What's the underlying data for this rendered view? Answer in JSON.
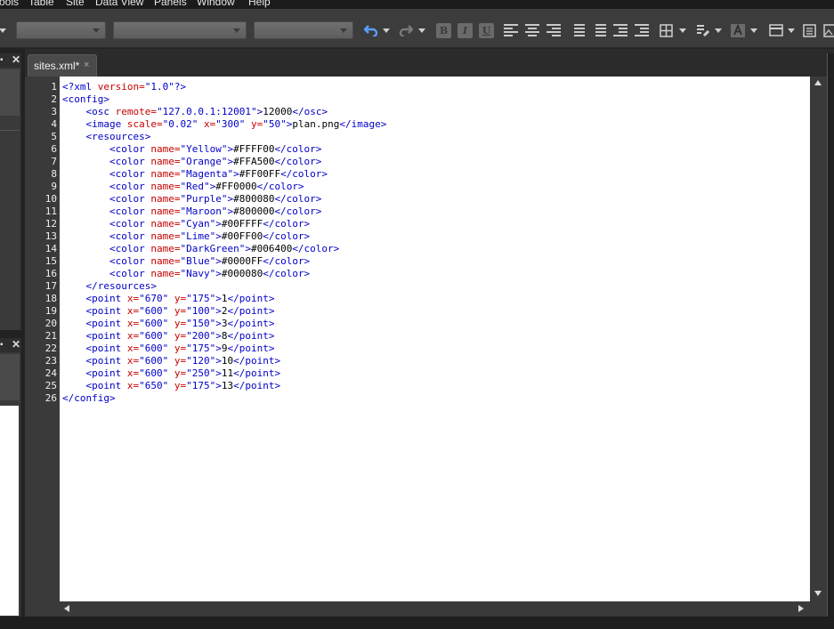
{
  "menu": {
    "items": [
      "ools",
      "Table",
      "Site",
      "Data View",
      "Panels",
      "Window",
      "Help"
    ]
  },
  "toolbar": {
    "bold_label": "B",
    "italic_label": "I",
    "underline_label": "U"
  },
  "tabs": [
    {
      "label": "sites.xml*",
      "close": "×"
    }
  ],
  "left_panel": {
    "pin": "▪",
    "close": "✕"
  },
  "colors": {
    "tag": "#0000c8",
    "attribute": "#c80000",
    "value": "#0000c8",
    "text": "#000000"
  },
  "editor": {
    "line_numbers": [
      "1",
      "2",
      "3",
      "4",
      "5",
      "6",
      "7",
      "8",
      "9",
      "10",
      "11",
      "12",
      "13",
      "14",
      "15",
      "16",
      "17",
      "18",
      "19",
      "20",
      "21",
      "22",
      "23",
      "24",
      "25",
      "26"
    ],
    "lines": [
      [
        {
          "c": "t",
          "s": "<?xml "
        },
        {
          "c": "a",
          "s": "version="
        },
        {
          "c": "v",
          "s": "\"1.0\""
        },
        {
          "c": "t",
          "s": "?>"
        }
      ],
      [
        {
          "c": "t",
          "s": "<config>"
        }
      ],
      [
        {
          "c": "x",
          "s": "    "
        },
        {
          "c": "t",
          "s": "<osc "
        },
        {
          "c": "a",
          "s": "remote="
        },
        {
          "c": "v",
          "s": "\"127.0.0.1:12001\""
        },
        {
          "c": "t",
          "s": ">"
        },
        {
          "c": "x",
          "s": "12000"
        },
        {
          "c": "t",
          "s": "</osc>"
        }
      ],
      [
        {
          "c": "x",
          "s": "    "
        },
        {
          "c": "t",
          "s": "<image "
        },
        {
          "c": "a",
          "s": "scale="
        },
        {
          "c": "v",
          "s": "\"0.02\""
        },
        {
          "c": "x",
          "s": " "
        },
        {
          "c": "a",
          "s": "x="
        },
        {
          "c": "v",
          "s": "\"300\""
        },
        {
          "c": "x",
          "s": " "
        },
        {
          "c": "a",
          "s": "y="
        },
        {
          "c": "v",
          "s": "\"50\""
        },
        {
          "c": "t",
          "s": ">"
        },
        {
          "c": "x",
          "s": "plan.png"
        },
        {
          "c": "t",
          "s": "</image>"
        }
      ],
      [
        {
          "c": "x",
          "s": "    "
        },
        {
          "c": "t",
          "s": "<resources>"
        }
      ],
      [
        {
          "c": "x",
          "s": "        "
        },
        {
          "c": "t",
          "s": "<color "
        },
        {
          "c": "a",
          "s": "name="
        },
        {
          "c": "v",
          "s": "\"Yellow\""
        },
        {
          "c": "t",
          "s": ">"
        },
        {
          "c": "x",
          "s": "#FFFF00"
        },
        {
          "c": "t",
          "s": "</color>"
        }
      ],
      [
        {
          "c": "x",
          "s": "        "
        },
        {
          "c": "t",
          "s": "<color "
        },
        {
          "c": "a",
          "s": "name="
        },
        {
          "c": "v",
          "s": "\"Orange\""
        },
        {
          "c": "t",
          "s": ">"
        },
        {
          "c": "x",
          "s": "#FFA500"
        },
        {
          "c": "t",
          "s": "</color>"
        }
      ],
      [
        {
          "c": "x",
          "s": "        "
        },
        {
          "c": "t",
          "s": "<color "
        },
        {
          "c": "a",
          "s": "name="
        },
        {
          "c": "v",
          "s": "\"Magenta\""
        },
        {
          "c": "t",
          "s": ">"
        },
        {
          "c": "x",
          "s": "#FF00FF"
        },
        {
          "c": "t",
          "s": "</color>"
        }
      ],
      [
        {
          "c": "x",
          "s": "        "
        },
        {
          "c": "t",
          "s": "<color "
        },
        {
          "c": "a",
          "s": "name="
        },
        {
          "c": "v",
          "s": "\"Red\""
        },
        {
          "c": "t",
          "s": ">"
        },
        {
          "c": "x",
          "s": "#FF0000"
        },
        {
          "c": "t",
          "s": "</color>"
        }
      ],
      [
        {
          "c": "x",
          "s": "        "
        },
        {
          "c": "t",
          "s": "<color "
        },
        {
          "c": "a",
          "s": "name="
        },
        {
          "c": "v",
          "s": "\"Purple\""
        },
        {
          "c": "t",
          "s": ">"
        },
        {
          "c": "x",
          "s": "#800080"
        },
        {
          "c": "t",
          "s": "</color>"
        }
      ],
      [
        {
          "c": "x",
          "s": "        "
        },
        {
          "c": "t",
          "s": "<color "
        },
        {
          "c": "a",
          "s": "name="
        },
        {
          "c": "v",
          "s": "\"Maroon\""
        },
        {
          "c": "t",
          "s": ">"
        },
        {
          "c": "x",
          "s": "#800000"
        },
        {
          "c": "t",
          "s": "</color>"
        }
      ],
      [
        {
          "c": "x",
          "s": "        "
        },
        {
          "c": "t",
          "s": "<color "
        },
        {
          "c": "a",
          "s": "name="
        },
        {
          "c": "v",
          "s": "\"Cyan\""
        },
        {
          "c": "t",
          "s": ">"
        },
        {
          "c": "x",
          "s": "#00FFFF"
        },
        {
          "c": "t",
          "s": "</color>"
        }
      ],
      [
        {
          "c": "x",
          "s": "        "
        },
        {
          "c": "t",
          "s": "<color "
        },
        {
          "c": "a",
          "s": "name="
        },
        {
          "c": "v",
          "s": "\"Lime\""
        },
        {
          "c": "t",
          "s": ">"
        },
        {
          "c": "x",
          "s": "#00FF00"
        },
        {
          "c": "t",
          "s": "</color>"
        }
      ],
      [
        {
          "c": "x",
          "s": "        "
        },
        {
          "c": "t",
          "s": "<color "
        },
        {
          "c": "a",
          "s": "name="
        },
        {
          "c": "v",
          "s": "\"DarkGreen\""
        },
        {
          "c": "t",
          "s": ">"
        },
        {
          "c": "x",
          "s": "#006400"
        },
        {
          "c": "t",
          "s": "</color>"
        }
      ],
      [
        {
          "c": "x",
          "s": "        "
        },
        {
          "c": "t",
          "s": "<color "
        },
        {
          "c": "a",
          "s": "name="
        },
        {
          "c": "v",
          "s": "\"Blue\""
        },
        {
          "c": "t",
          "s": ">"
        },
        {
          "c": "x",
          "s": "#0000FF"
        },
        {
          "c": "t",
          "s": "</color>"
        }
      ],
      [
        {
          "c": "x",
          "s": "        "
        },
        {
          "c": "t",
          "s": "<color "
        },
        {
          "c": "a",
          "s": "name="
        },
        {
          "c": "v",
          "s": "\"Navy\""
        },
        {
          "c": "t",
          "s": ">"
        },
        {
          "c": "x",
          "s": "#000080"
        },
        {
          "c": "t",
          "s": "</color>"
        }
      ],
      [
        {
          "c": "x",
          "s": "    "
        },
        {
          "c": "t",
          "s": "</resources>"
        }
      ],
      [
        {
          "c": "x",
          "s": "    "
        },
        {
          "c": "t",
          "s": "<point "
        },
        {
          "c": "a",
          "s": "x="
        },
        {
          "c": "v",
          "s": "\"670\""
        },
        {
          "c": "x",
          "s": " "
        },
        {
          "c": "a",
          "s": "y="
        },
        {
          "c": "v",
          "s": "\"175\""
        },
        {
          "c": "t",
          "s": ">"
        },
        {
          "c": "x",
          "s": "1"
        },
        {
          "c": "t",
          "s": "</point>"
        }
      ],
      [
        {
          "c": "x",
          "s": "    "
        },
        {
          "c": "t",
          "s": "<point "
        },
        {
          "c": "a",
          "s": "x="
        },
        {
          "c": "v",
          "s": "\"600\""
        },
        {
          "c": "x",
          "s": " "
        },
        {
          "c": "a",
          "s": "y="
        },
        {
          "c": "v",
          "s": "\"100\""
        },
        {
          "c": "t",
          "s": ">"
        },
        {
          "c": "x",
          "s": "2"
        },
        {
          "c": "t",
          "s": "</point>"
        }
      ],
      [
        {
          "c": "x",
          "s": "    "
        },
        {
          "c": "t",
          "s": "<point "
        },
        {
          "c": "a",
          "s": "x="
        },
        {
          "c": "v",
          "s": "\"600\""
        },
        {
          "c": "x",
          "s": " "
        },
        {
          "c": "a",
          "s": "y="
        },
        {
          "c": "v",
          "s": "\"150\""
        },
        {
          "c": "t",
          "s": ">"
        },
        {
          "c": "x",
          "s": "3"
        },
        {
          "c": "t",
          "s": "</point>"
        }
      ],
      [
        {
          "c": "x",
          "s": "    "
        },
        {
          "c": "t",
          "s": "<point "
        },
        {
          "c": "a",
          "s": "x="
        },
        {
          "c": "v",
          "s": "\"600\""
        },
        {
          "c": "x",
          "s": " "
        },
        {
          "c": "a",
          "s": "y="
        },
        {
          "c": "v",
          "s": "\"200\""
        },
        {
          "c": "t",
          "s": ">"
        },
        {
          "c": "x",
          "s": "8"
        },
        {
          "c": "t",
          "s": "</point>"
        }
      ],
      [
        {
          "c": "x",
          "s": "    "
        },
        {
          "c": "t",
          "s": "<point "
        },
        {
          "c": "a",
          "s": "x="
        },
        {
          "c": "v",
          "s": "\"600\""
        },
        {
          "c": "x",
          "s": " "
        },
        {
          "c": "a",
          "s": "y="
        },
        {
          "c": "v",
          "s": "\"175\""
        },
        {
          "c": "t",
          "s": ">"
        },
        {
          "c": "x",
          "s": "9"
        },
        {
          "c": "t",
          "s": "</point>"
        }
      ],
      [
        {
          "c": "x",
          "s": "    "
        },
        {
          "c": "t",
          "s": "<point "
        },
        {
          "c": "a",
          "s": "x="
        },
        {
          "c": "v",
          "s": "\"600\""
        },
        {
          "c": "x",
          "s": " "
        },
        {
          "c": "a",
          "s": "y="
        },
        {
          "c": "v",
          "s": "\"120\""
        },
        {
          "c": "t",
          "s": ">"
        },
        {
          "c": "x",
          "s": "10"
        },
        {
          "c": "t",
          "s": "</point>"
        }
      ],
      [
        {
          "c": "x",
          "s": "    "
        },
        {
          "c": "t",
          "s": "<point "
        },
        {
          "c": "a",
          "s": "x="
        },
        {
          "c": "v",
          "s": "\"600\""
        },
        {
          "c": "x",
          "s": " "
        },
        {
          "c": "a",
          "s": "y="
        },
        {
          "c": "v",
          "s": "\"250\""
        },
        {
          "c": "t",
          "s": ">"
        },
        {
          "c": "x",
          "s": "11"
        },
        {
          "c": "t",
          "s": "</point>"
        }
      ],
      [
        {
          "c": "x",
          "s": "    "
        },
        {
          "c": "t",
          "s": "<point "
        },
        {
          "c": "a",
          "s": "x="
        },
        {
          "c": "v",
          "s": "\"650\""
        },
        {
          "c": "x",
          "s": " "
        },
        {
          "c": "a",
          "s": "y="
        },
        {
          "c": "v",
          "s": "\"175\""
        },
        {
          "c": "t",
          "s": ">"
        },
        {
          "c": "x",
          "s": "13"
        },
        {
          "c": "t",
          "s": "</point>"
        }
      ],
      [
        {
          "c": "t",
          "s": "</config>"
        }
      ]
    ]
  }
}
